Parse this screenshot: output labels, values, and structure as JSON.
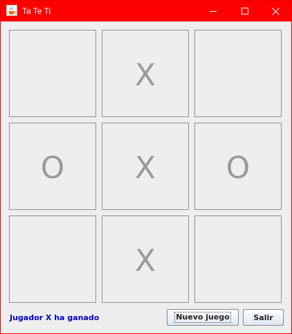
{
  "window": {
    "title": "Ta Te Ti",
    "app_icon": "java-coffee-cup-icon",
    "controls": [
      "minimize-icon",
      "maximize-icon",
      "close-icon"
    ],
    "titlebar_color": "#ff0000"
  },
  "board": {
    "cells": [
      {
        "mark": ""
      },
      {
        "mark": "X"
      },
      {
        "mark": ""
      },
      {
        "mark": "O"
      },
      {
        "mark": "X"
      },
      {
        "mark": "O"
      },
      {
        "mark": ""
      },
      {
        "mark": "X"
      },
      {
        "mark": ""
      }
    ],
    "mark_color": "#9a9a9a"
  },
  "status": {
    "text": "Jugador X ha ganado",
    "color": "#0000cc"
  },
  "buttons": {
    "new_game_label": "Nuevo juego",
    "exit_label": "Salir"
  }
}
